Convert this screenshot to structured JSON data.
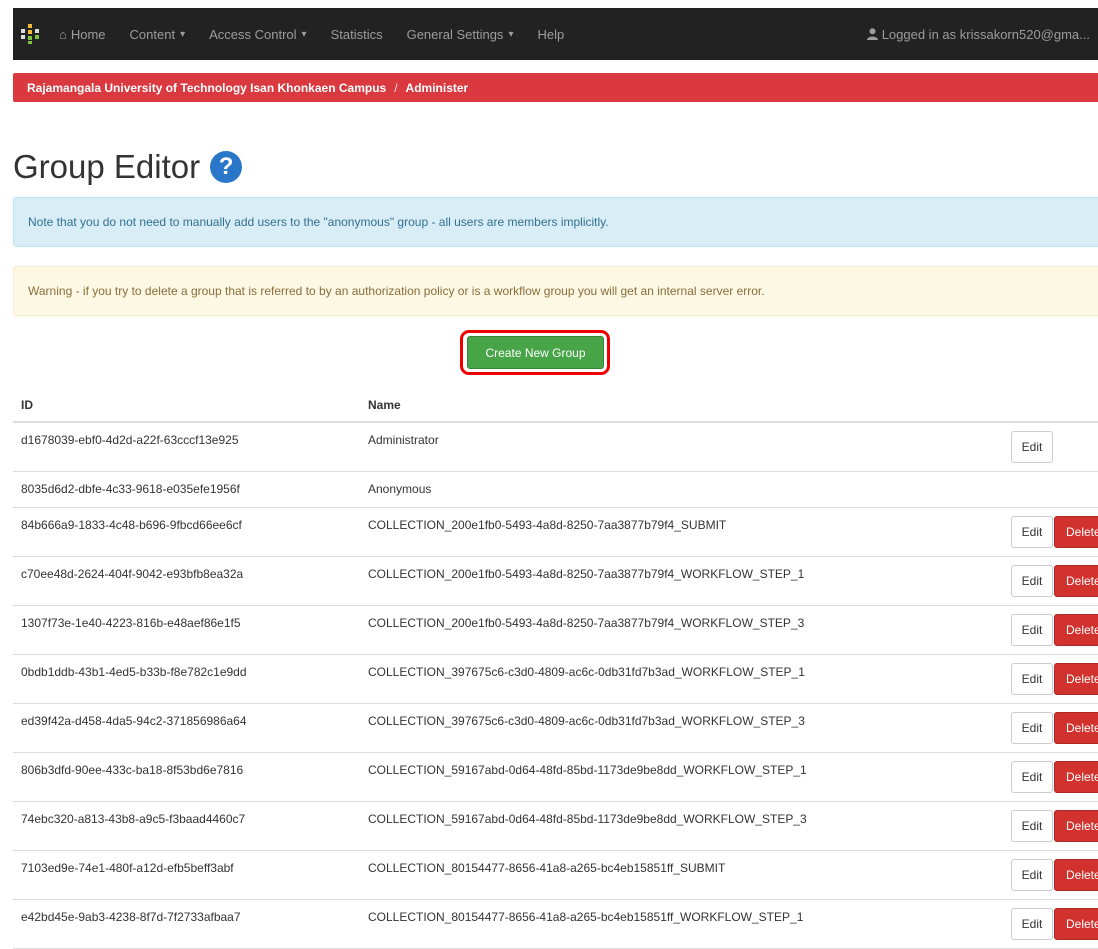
{
  "navbar": {
    "items": [
      {
        "label": "Home",
        "icon": "home-icon"
      },
      {
        "label": "Content",
        "dropdown": true
      },
      {
        "label": "Access Control",
        "dropdown": true
      },
      {
        "label": "Statistics"
      },
      {
        "label": "General Settings",
        "dropdown": true
      },
      {
        "label": "Help"
      }
    ],
    "user_text": "Logged in as krissakorn520@gma..."
  },
  "breadcrumb": {
    "parent": "Rajamangala University of Technology Isan Khonkaen Campus",
    "separator": "/",
    "current": "Administer"
  },
  "page": {
    "title": "Group Editor",
    "help_symbol": "?"
  },
  "alerts": {
    "info": "Note that you do not need to manually add users to the \"anonymous\" group - all users are members implicitly.",
    "warning": "Warning - if you try to delete a group that is referred to by an authorization policy or is a workflow group you will get an internal server error."
  },
  "create_button": "Create New Group",
  "table": {
    "headers": {
      "id": "ID",
      "name": "Name"
    },
    "edit_label": "Edit",
    "delete_label": "Delete",
    "rows": [
      {
        "id": "d1678039-ebf0-4d2d-a22f-63cccf13e925",
        "name": "Administrator",
        "edit": true,
        "delete": false
      },
      {
        "id": "8035d6d2-dbfe-4c33-9618-e035efe1956f",
        "name": "Anonymous",
        "edit": false,
        "delete": false
      },
      {
        "id": "84b666a9-1833-4c48-b696-9fbcd66ee6cf",
        "name": "COLLECTION_200e1fb0-5493-4a8d-8250-7aa3877b79f4_SUBMIT",
        "edit": true,
        "delete": true
      },
      {
        "id": "c70ee48d-2624-404f-9042-e93bfb8ea32a",
        "name": "COLLECTION_200e1fb0-5493-4a8d-8250-7aa3877b79f4_WORKFLOW_STEP_1",
        "edit": true,
        "delete": true
      },
      {
        "id": "1307f73e-1e40-4223-816b-e48aef86e1f5",
        "name": "COLLECTION_200e1fb0-5493-4a8d-8250-7aa3877b79f4_WORKFLOW_STEP_3",
        "edit": true,
        "delete": true
      },
      {
        "id": "0bdb1ddb-43b1-4ed5-b33b-f8e782c1e9dd",
        "name": "COLLECTION_397675c6-c3d0-4809-ac6c-0db31fd7b3ad_WORKFLOW_STEP_1",
        "edit": true,
        "delete": true
      },
      {
        "id": "ed39f42a-d458-4da5-94c2-371856986a64",
        "name": "COLLECTION_397675c6-c3d0-4809-ac6c-0db31fd7b3ad_WORKFLOW_STEP_3",
        "edit": true,
        "delete": true
      },
      {
        "id": "806b3dfd-90ee-433c-ba18-8f53bd6e7816",
        "name": "COLLECTION_59167abd-0d64-48fd-85bd-1173de9be8dd_WORKFLOW_STEP_1",
        "edit": true,
        "delete": true
      },
      {
        "id": "74ebc320-a813-43b8-a9c5-f3baad4460c7",
        "name": "COLLECTION_59167abd-0d64-48fd-85bd-1173de9be8dd_WORKFLOW_STEP_3",
        "edit": true,
        "delete": true
      },
      {
        "id": "7103ed9e-74e1-480f-a12d-efb5beff3abf",
        "name": "COLLECTION_80154477-8656-41a8-a265-bc4eb15851ff_SUBMIT",
        "edit": true,
        "delete": true
      },
      {
        "id": "e42bd45e-9ab3-4238-8f7d-7f2733afbaa7",
        "name": "COLLECTION_80154477-8656-41a8-a265-bc4eb15851ff_WORKFLOW_STEP_1",
        "edit": true,
        "delete": true
      }
    ]
  }
}
